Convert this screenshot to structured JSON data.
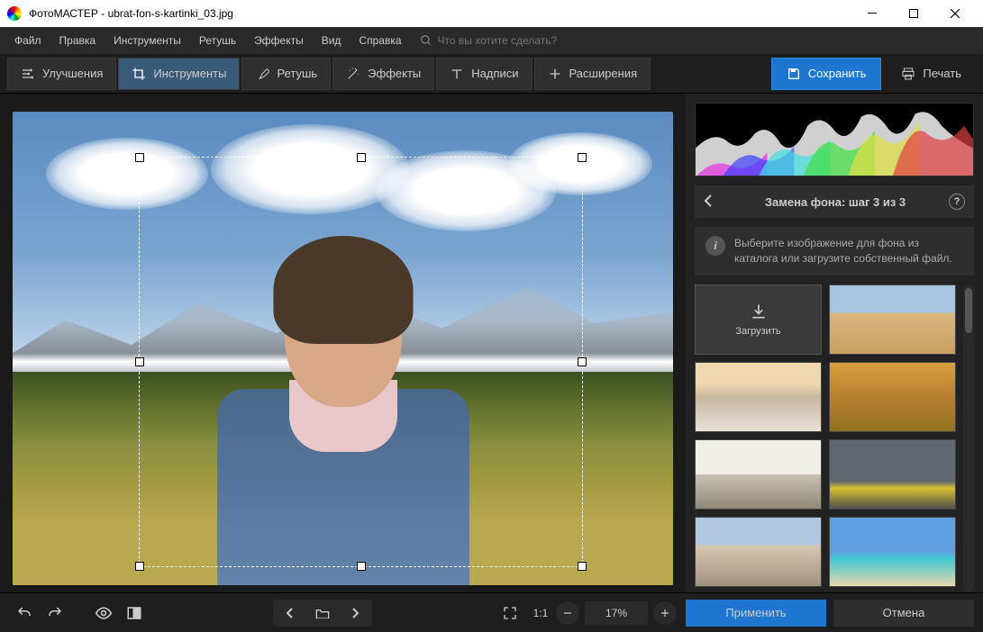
{
  "titlebar": {
    "title": "ФотоМАСТЕР - ubrat-fon-s-kartinki_03.jpg"
  },
  "menu": {
    "file": "Файл",
    "edit": "Правка",
    "tools": "Инструменты",
    "retouch": "Ретушь",
    "effects": "Эффекты",
    "view": "Вид",
    "help": "Справка",
    "search_placeholder": "Что вы хотите сделать?"
  },
  "toolbar": {
    "enhance": "Улучшения",
    "tools": "Инструменты",
    "retouch": "Ретушь",
    "effects": "Эффекты",
    "text": "Надписи",
    "extensions": "Расширения",
    "save": "Сохранить",
    "print": "Печать"
  },
  "panel": {
    "step_title": "Замена фона: шаг 3 из 3",
    "info_text": "Выберите изображение для фона из каталога или загрузите собственный файл.",
    "upload": "Загрузить"
  },
  "bottom": {
    "zoom_pct": "17%",
    "ratio": "1:1",
    "apply": "Применить",
    "cancel": "Отмена"
  }
}
